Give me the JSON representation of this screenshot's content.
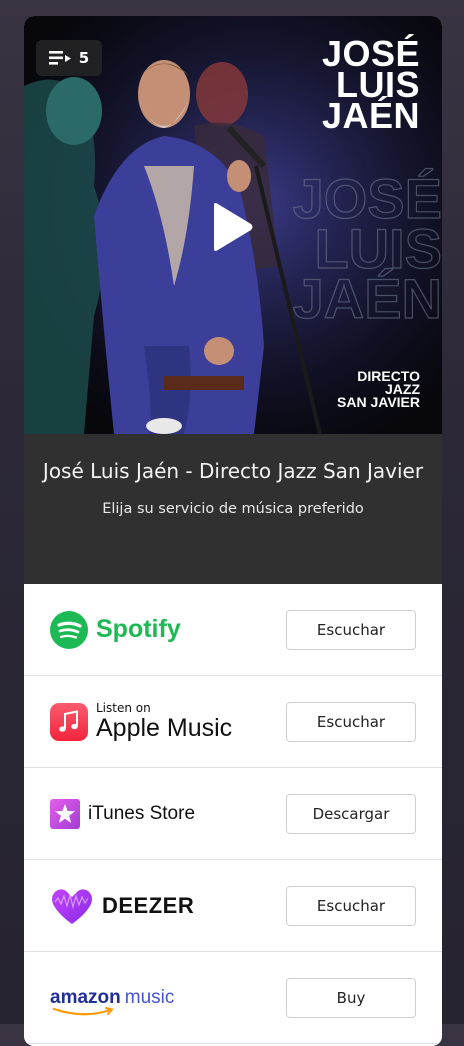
{
  "cover": {
    "queue_count": "5",
    "artist_title_lines": [
      "JOSÉ",
      "LUIS",
      "JAÉN"
    ],
    "ghost_lines": [
      "JOSÉ",
      "LUIS",
      "JAÉN"
    ],
    "subtitle_lines": [
      "DIRECTO",
      "JAZZ",
      "SAN JAVIER"
    ]
  },
  "info": {
    "title": "José Luis Jaén - Directo Jazz San Javier",
    "subtitle": "Elija su servicio de música preferido"
  },
  "services": [
    {
      "name": "Spotify",
      "action": "Escuchar",
      "color": "#1db954"
    },
    {
      "name_small": "Listen on",
      "name": "Apple Music",
      "action": "Escuchar",
      "color": "#fa243c"
    },
    {
      "name": "iTunes Store",
      "action": "Descargar",
      "color": "#d84bd9"
    },
    {
      "name": "DEEZER",
      "action": "Escuchar",
      "color": "#a238ff"
    },
    {
      "name_brand": "amazon",
      "name": "music",
      "action": "Buy",
      "color": "#232f99"
    }
  ]
}
